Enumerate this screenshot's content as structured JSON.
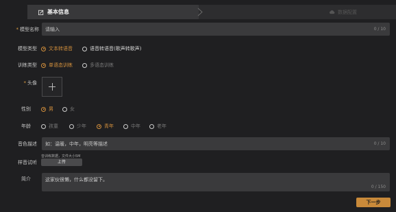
{
  "steps": [
    {
      "label": "基本信息",
      "active": true
    },
    {
      "label": "数据配置",
      "active": false
    }
  ],
  "form": {
    "name": {
      "label": "模型名称",
      "required": true,
      "placeholder": "请输入",
      "count": "0 / 10"
    },
    "model_type": {
      "label": "模型类型",
      "options": [
        "文本转语音",
        "语音转语音(歌声转歌声)"
      ],
      "selected": 0
    },
    "train_type": {
      "label": "训练类型",
      "options": [
        "单语态训练",
        "多语态训练"
      ],
      "selected": 0
    },
    "avatar": {
      "label": "头像",
      "required": true
    },
    "gender": {
      "label": "性别",
      "options": [
        "男",
        "女"
      ],
      "selected": 0
    },
    "age": {
      "label": "年龄",
      "options": [
        "孩童",
        "少年",
        "青年",
        "中年",
        "老年"
      ],
      "selected": 2
    },
    "timbre": {
      "label": "音色描述",
      "placeholder": "如：温暖，中年，明亮等描述",
      "count": "0 / 10"
    },
    "sample": {
      "label": "样音试听",
      "hint": "音训练数据，文件大小5M",
      "upload_label": "上传"
    },
    "intro": {
      "label": "简介",
      "value": "这家伙很懒，什么都没留下。",
      "count": "0 / 150"
    }
  },
  "next_label": "下一步",
  "colors": {
    "accent": "#d28f3c",
    "background": "#1f1f21",
    "input": "#3a3a3c"
  }
}
